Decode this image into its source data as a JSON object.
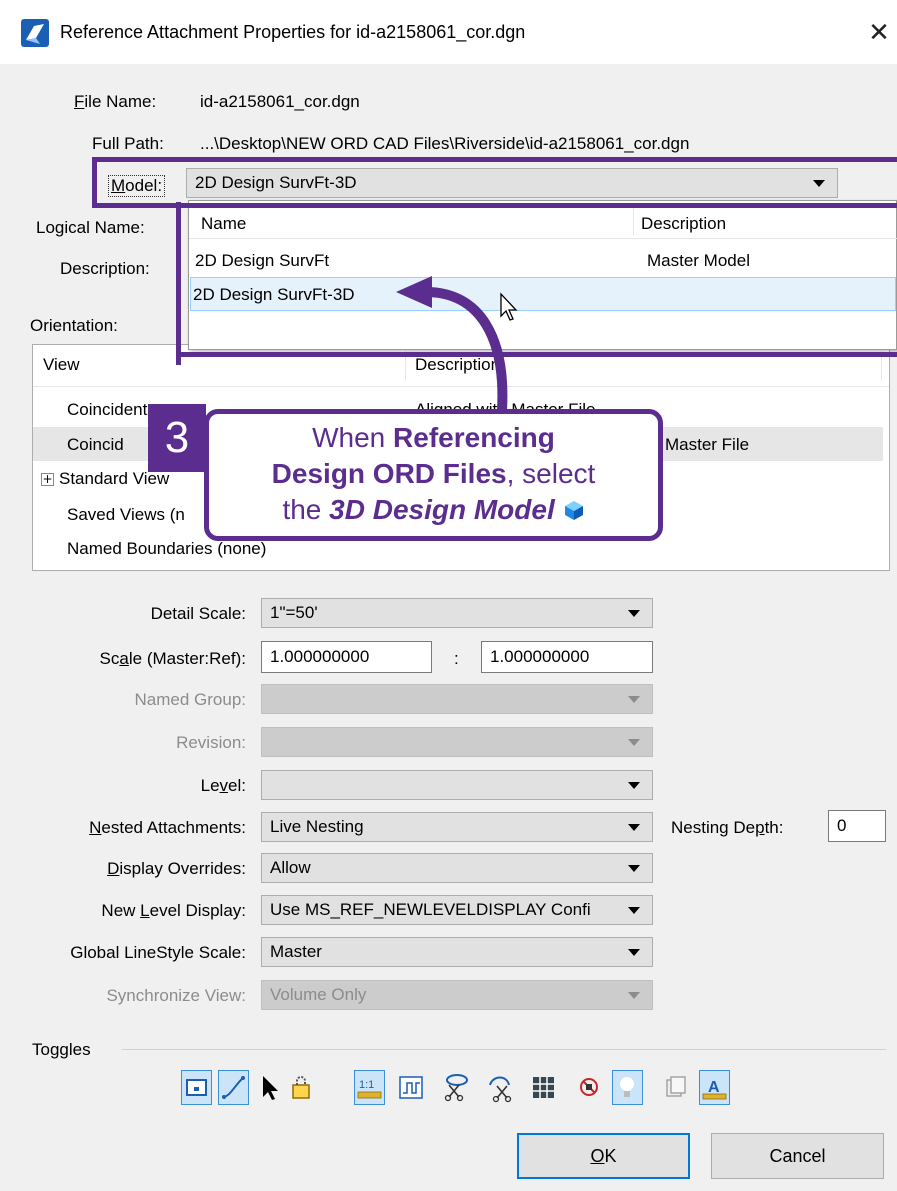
{
  "window": {
    "title": "Reference Attachment Properties for id-a2158061_cor.dgn",
    "close_glyph": "✕"
  },
  "file_name": {
    "label": "File Name:",
    "value": "id-a2158061_cor.dgn"
  },
  "full_path": {
    "label": "Full Path:",
    "value": "...\\Desktop\\NEW ORD CAD Files\\Riverside\\id-a2158061_cor.dgn"
  },
  "model": {
    "label": "Model:",
    "value": "2D Design SurvFt-3D",
    "dropdown": {
      "headers": [
        "Name",
        "Description"
      ],
      "rows": [
        {
          "name": "2D Design SurvFt",
          "description": "Master Model"
        },
        {
          "name": "2D Design SurvFt-3D",
          "description": ""
        }
      ]
    }
  },
  "logical_name": {
    "label": "Logical Name:"
  },
  "description": {
    "label": "Description:"
  },
  "orientation": {
    "label": "Orientation:",
    "headers": [
      "View",
      "Description"
    ],
    "rows": [
      {
        "view": "Coincident",
        "description": "Aligned with Master File"
      },
      {
        "view": "Coincident - World",
        "description": "Aligned with Master File"
      },
      {
        "view": "Standard Views",
        "description": ""
      },
      {
        "view": "Saved Views (none)",
        "description": ""
      },
      {
        "view": "Named Boundaries (none)",
        "description": ""
      }
    ],
    "visible_fragments": {
      "row1_view": "Coincident",
      "row1_desc": "Aligned with Master File",
      "row2_view": "Coincid",
      "row2_desc": "Master File",
      "row3_view": "Standard View",
      "row4_view": "Saved Views (n",
      "row5_view": "Named Boundaries (none)",
      "head_desc": "Description"
    }
  },
  "callout": {
    "step": "3",
    "line1_a": "When ",
    "line1_b": "Referencing",
    "line2_a": "Design ORD Files",
    "line2_b": ", select",
    "line3_a": "the ",
    "line3_b": "3D Design Model",
    "accent_color": "#5b2d8e"
  },
  "fields": {
    "detail_scale": {
      "label": "Detail Scale:",
      "value": "1\"=50'"
    },
    "scale": {
      "label": "Scale (Master:Ref):",
      "master": "1.000000000",
      "separator": ":",
      "ref": "1.000000000"
    },
    "named_group": {
      "label": "Named Group:",
      "value": ""
    },
    "revision": {
      "label": "Revision:",
      "value": ""
    },
    "level": {
      "label": "Level:",
      "value": ""
    },
    "nested_attachments": {
      "label": "Nested Attachments:",
      "value": "Live Nesting"
    },
    "nesting_depth": {
      "label": "Nesting Depth:",
      "value": "0"
    },
    "display_overrides": {
      "label": "Display Overrides:",
      "value": "Allow"
    },
    "new_level_display": {
      "label": "New Level Display:",
      "value": "Use MS_REF_NEWLEVELDISPLAY Confi"
    },
    "global_linestyle_scale": {
      "label": "Global LineStyle Scale:",
      "value": "Master"
    },
    "synchronize_view": {
      "label": "Synchronize View:",
      "value": "Volume Only"
    }
  },
  "toggles": {
    "label": "Toggles",
    "items": [
      {
        "icon": "display-icon",
        "on": true
      },
      {
        "icon": "snap-icon",
        "on": true
      },
      {
        "icon": "locate-icon",
        "on": false
      },
      {
        "icon": "lock-icon",
        "on": false
      },
      {
        "icon": "true-scale-icon",
        "on": true
      },
      {
        "icon": "scale-line-styles-icon",
        "on": false
      },
      {
        "icon": "ignore-attachment-icon",
        "on": false
      },
      {
        "icon": "clip-back-icon",
        "on": false
      },
      {
        "icon": "raster-icon",
        "on": false
      },
      {
        "icon": "treat-as-element-icon",
        "on": false
      },
      {
        "icon": "use-lights-icon",
        "on": true
      },
      {
        "icon": "display-raster-icon",
        "on": false
      },
      {
        "icon": "annotation-scale-icon",
        "on": true
      }
    ]
  },
  "buttons": {
    "ok": "OK",
    "cancel": "Cancel"
  }
}
